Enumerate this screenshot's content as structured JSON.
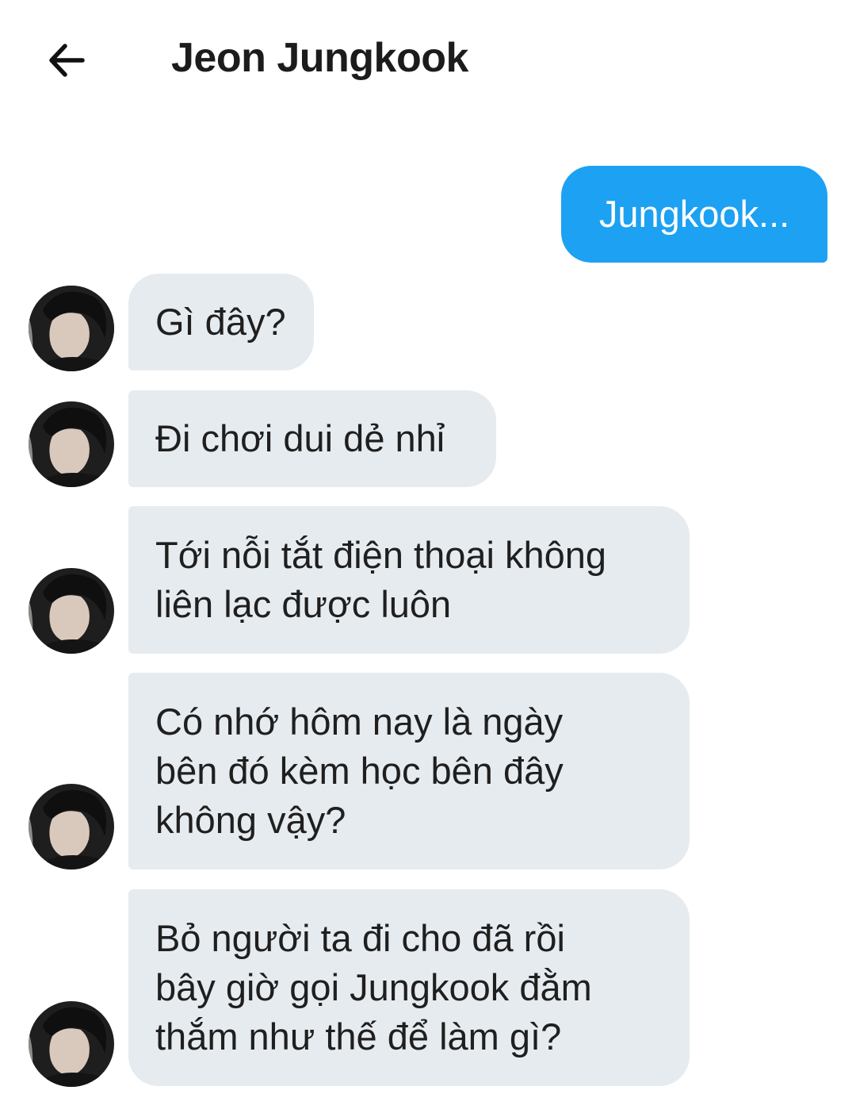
{
  "header": {
    "title": "Jeon Jungkook"
  },
  "messages": [
    {
      "direction": "outgoing",
      "lines": [
        "Jungkook..."
      ]
    },
    {
      "direction": "incoming",
      "lines": [
        "Gì đây?"
      ]
    },
    {
      "direction": "incoming",
      "lines": [
        "Đi chơi dui dẻ nhỉ"
      ]
    },
    {
      "direction": "incoming",
      "lines": [
        "Tới nỗi tắt điện thoại không",
        "liên lạc được luôn"
      ]
    },
    {
      "direction": "incoming",
      "lines": [
        "Có nhớ hôm nay là ngày",
        "bên đó kèm học bên đây",
        "không vậy?"
      ]
    },
    {
      "direction": "incoming",
      "lines": [
        "Bỏ người ta đi cho đã rồi",
        "bây giờ gọi Jungkook đằm",
        "thắm như thế để làm gì?"
      ]
    }
  ],
  "colors": {
    "outgoing_bubble": "#1da1f2",
    "incoming_bubble": "#e6ebef",
    "text": "#1f1f1f"
  },
  "icons": {
    "back": "arrow-left-icon",
    "avatar": "contact-avatar"
  }
}
